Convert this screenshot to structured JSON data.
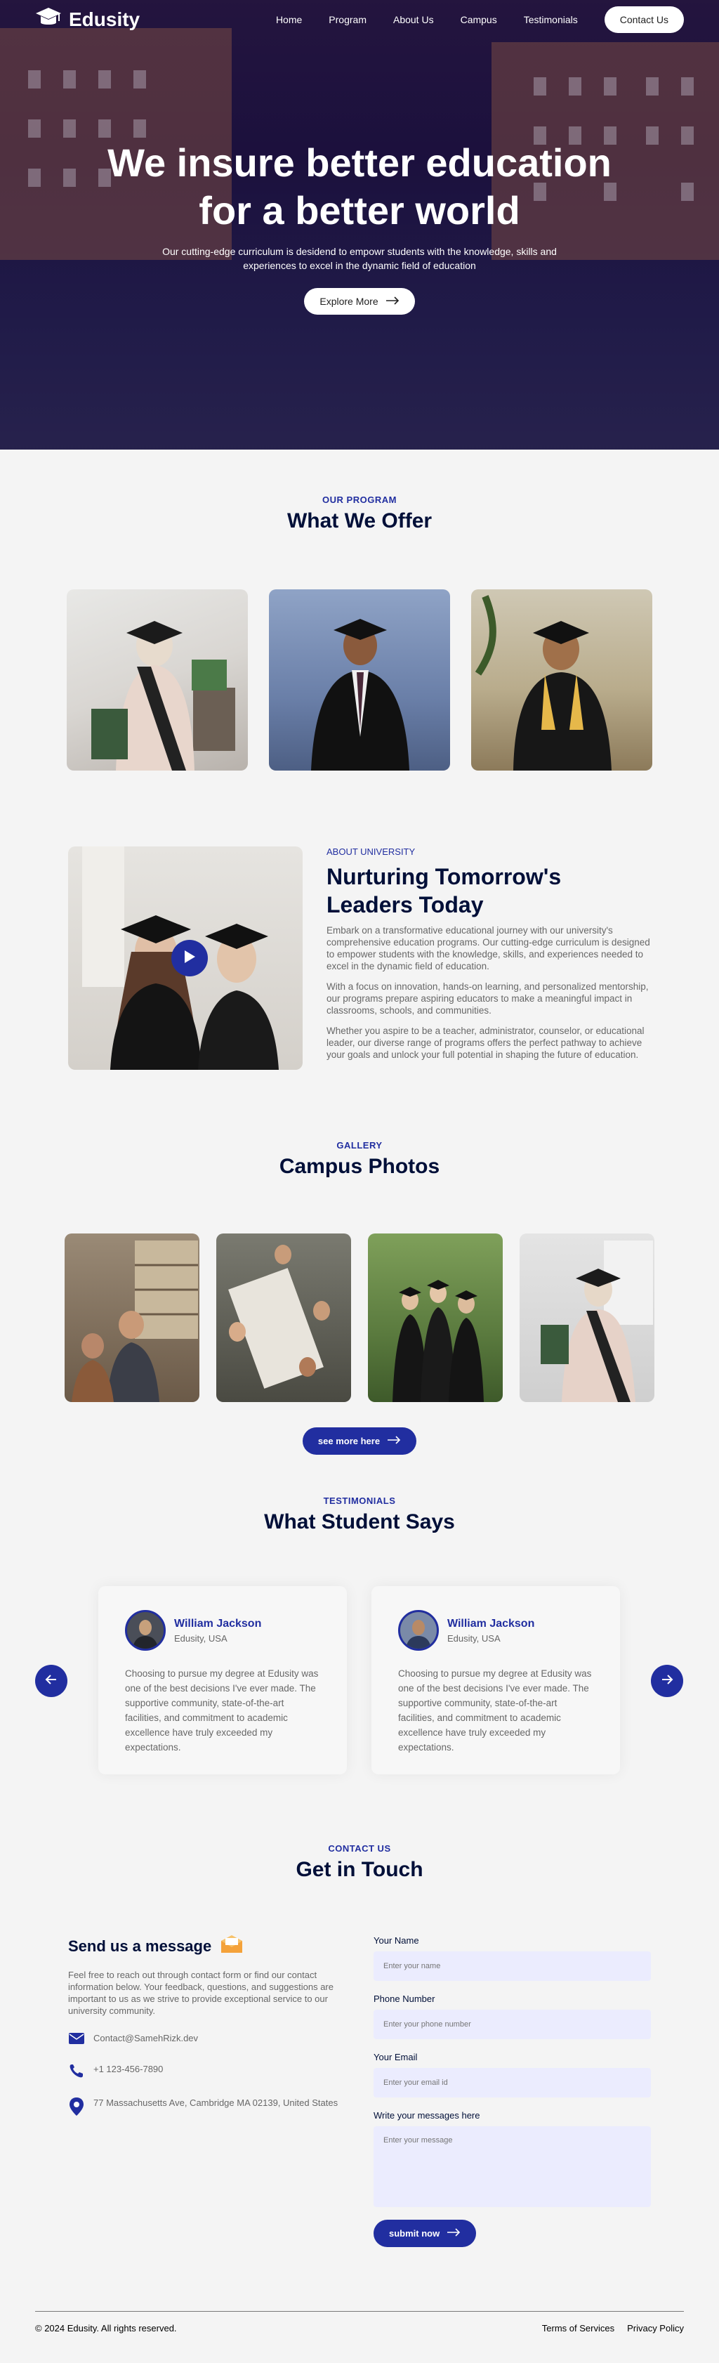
{
  "nav": {
    "logo": "Edusity",
    "links": [
      "Home",
      "Program",
      "About Us",
      "Campus",
      "Testimonials"
    ],
    "cta": "Contact Us"
  },
  "hero": {
    "title_line1": "We insure better education",
    "title_line2": "for a better world",
    "subtitle": "Our cutting-edge curriculum is desidend to empowr students with the knowledge, skills and experiences to excel in the dynamic field of education",
    "button": "Explore More"
  },
  "program": {
    "subtitle": "OUR PROGRAM",
    "title": "What We Offer"
  },
  "about": {
    "label": "ABOUT UNIVERSITY",
    "title": "Nurturing Tomorrow's Leaders Today",
    "p1": "Embark on a transformative educational journey with our university's comprehensive education programs. Our cutting-edge curriculum is designed to empower students with the knowledge, skills, and experiences needed to excel in the dynamic field of education.",
    "p2": "With a focus on innovation, hands-on learning, and personalized mentorship, our programs prepare aspiring educators to make a meaningful impact in classrooms, schools, and communities.",
    "p3": "Whether you aspire to be a teacher, administrator, counselor, or educational leader, our diverse range of programs offers the perfect pathway to achieve your goals and unlock your full potential in shaping the future of education."
  },
  "gallery": {
    "subtitle": "GALLERY",
    "title": "Campus Photos",
    "button": "see more here"
  },
  "testimonials": {
    "subtitle": "TESTIMONIALS",
    "title": "What Student Says",
    "cards": [
      {
        "name": "William Jackson",
        "location": "Edusity, USA",
        "text": "Choosing to pursue my degree at Edusity was one of the best decisions I've ever made. The supportive community, state-of-the-art facilities, and commitment to academic excellence have truly exceeded my expectations."
      },
      {
        "name": "William Jackson",
        "location": "Edusity, USA",
        "text": "Choosing to pursue my degree at Edusity was one of the best decisions I've ever made. The supportive community, state-of-the-art facilities, and commitment to academic excellence have truly exceeded my expectations."
      }
    ]
  },
  "contact": {
    "subtitle": "CONTACT US",
    "title": "Get in Touch",
    "heading": "Send us a message",
    "text": "Feel free to reach out through contact form or find our contact information below. Your feedback, questions, and suggestions are important to us as we strive to provide exceptional service to our university community.",
    "email": "Contact@SamehRizk.dev",
    "phone": "+1 123-456-7890",
    "address": "77 Massachusetts Ave, Cambridge MA 02139, United States",
    "form": {
      "name_label": "Your Name",
      "name_ph": "Enter your name",
      "phone_label": "Phone Number",
      "phone_ph": "Enter your phone number",
      "email_label": "Your Email",
      "email_ph": "Enter your email id",
      "msg_label": "Write your messages here",
      "msg_ph": "Enter your message",
      "submit": "submit now"
    }
  },
  "footer": {
    "copyright": "© 2024 Edusity. All rights reserved.",
    "links": [
      "Terms of Services",
      "Privacy Policy"
    ]
  },
  "colors": {
    "primary": "#212ea0",
    "dark": "#000f38",
    "overlay": "#08003a"
  }
}
